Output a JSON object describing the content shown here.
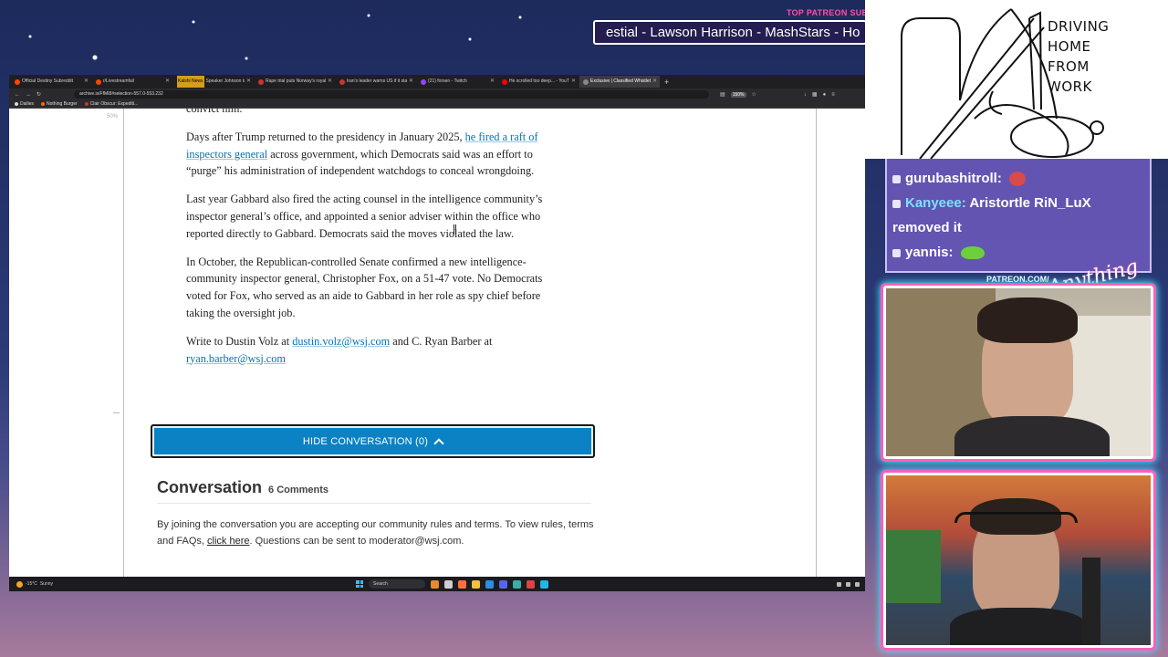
{
  "stream": {
    "ticker_heading": "TOP PATREON SUBS",
    "ticker_text": "estial - Lawson Harrison - MashStars - Ho"
  },
  "browser": {
    "tabs": [
      {
        "label": "Official Destiny Subreddit",
        "color": "#ff4500",
        "active": false
      },
      {
        "label": "r/Livestreamfail",
        "color": "#ff4500",
        "active": false
      },
      {
        "label": "Speaker Johnson is 'confident'",
        "color": "#d43",
        "active": false,
        "badge": "Kalshi News"
      },
      {
        "label": "Rape trial puts Norway's royal f",
        "color": "#c33",
        "active": false
      },
      {
        "label": "Iran's leader warns US if it start",
        "color": "#c33",
        "active": false
      },
      {
        "label": "(21) forsen - Twitch",
        "color": "#9146ff",
        "active": false
      },
      {
        "label": "He scrolled too deep... - YouTub",
        "color": "#ff0000",
        "active": false
      },
      {
        "label": "Exclusive | Classified Whistleblo",
        "color": "#888",
        "active": true
      }
    ],
    "url": "archive.is/FfMI8#selection-557.0-553.232",
    "zoom": "150%",
    "bookmarks": [
      {
        "label": "Dailies",
        "color": "#d9d9d9"
      },
      {
        "label": "Nothing Burger",
        "color": "#ff6a00"
      },
      {
        "label": "Clair Obscur: Expediti...",
        "color": "#c0392b"
      }
    ]
  },
  "page": {
    "zoom_label": "50%",
    "article": {
      "fragment_end": "convict him.",
      "p1_text_before": "Days after Trump returned to the presidency in January 2025, ",
      "p1_link": "he fired a raft of inspectors general",
      "p1_text_after": " across government, which Democrats said was an effort to “purge” his administration of independent watchdogs to conceal wrongdoing.",
      "p2": "Last year Gabbard also fired the acting counsel in the intelligence community’s inspector general’s office, and appointed a senior adviser within the office who reported directly to Gabbard. Democrats said the moves violated the law.",
      "p3": "In October, the Republican-controlled Senate confirmed a new intelligence-community inspector general, Christopher Fox, on a 51-47 vote. No Democrats voted for Fox, who served as an aide to Gabbard in her role as spy chief before taking the oversight job.",
      "contact_prefix": "Write to Dustin Volz at ",
      "contact_email1": "dustin.volz@wsj.com",
      "contact_mid": " and C. Ryan Barber at ",
      "contact_email2": "ryan.barber@wsj.com"
    },
    "conversation": {
      "button_label": "HIDE CONVERSATION (0)",
      "title": "Conversation",
      "count": "6 Comments",
      "rules_before": "By joining the conversation you are accepting our community rules and terms. To view rules, terms and FAQs, ",
      "rules_link": "click here",
      "rules_after": ". Questions can be sent to moderator@wsj.com."
    }
  },
  "taskbar": {
    "temp": "-15°C",
    "weather": "Sunny",
    "search": "Search"
  },
  "drawing": {
    "caption": "DRIVING\nHOME\nFROM\nWORK"
  },
  "chat": {
    "messages": [
      {
        "user": "gurubashitroll:",
        "message": "",
        "emote_color": "#d94a4a",
        "user_color": "#ffffff"
      },
      {
        "user": "Kanyeee:",
        "message": "Aristortle RiN_LuX removed it",
        "emote_color": "",
        "user_color": "#7de0ff"
      },
      {
        "user": "yannis:",
        "message": "",
        "emote_color": "#6ccf3c",
        "user_color": "#ffffff"
      }
    ]
  },
  "overlay": {
    "patreon_url": "PATREON.COM/",
    "brand_script": "Anything Else?"
  }
}
